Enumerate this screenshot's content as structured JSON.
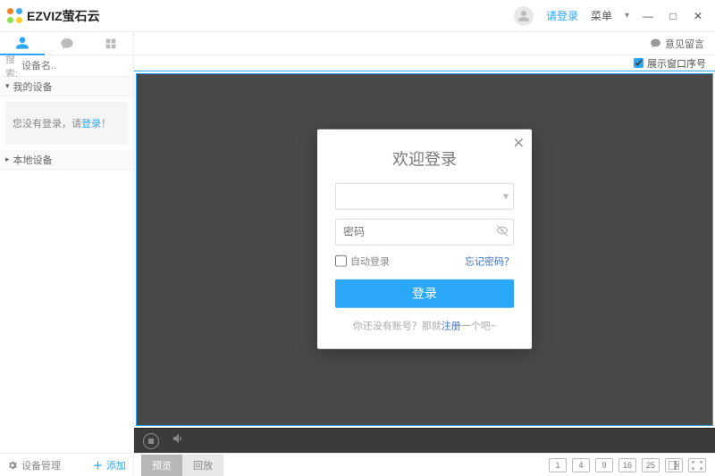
{
  "brand": "EZVIZ萤石云",
  "titlebar": {
    "login": "请登录",
    "menu": "菜单"
  },
  "subbar": {
    "feedback": "意见留言"
  },
  "sidebar": {
    "search_label": "搜索:",
    "search_placeholder": "设备名..",
    "my_devices": "我的设备",
    "not_logged_prefix": "您没有登录，请",
    "not_logged_link": "登录",
    "not_logged_suffix": "！",
    "local_devices": "本地设备"
  },
  "viewer": {
    "show_window_index": "展示窗口序号"
  },
  "bottombar": {
    "device_mgmt": "设备管理",
    "add": "添加",
    "preview": "预览",
    "playback": "回放",
    "grids": [
      "1",
      "4",
      "9",
      "16",
      "25"
    ]
  },
  "modal": {
    "title": "欢迎登录",
    "password_placeholder": "密码",
    "auto_login": "自动登录",
    "forgot": "忘记密码？",
    "submit": "登录",
    "reg_prefix": "你还没有账号？那就",
    "reg_link": "注册",
    "reg_suffix": "一个吧~"
  }
}
